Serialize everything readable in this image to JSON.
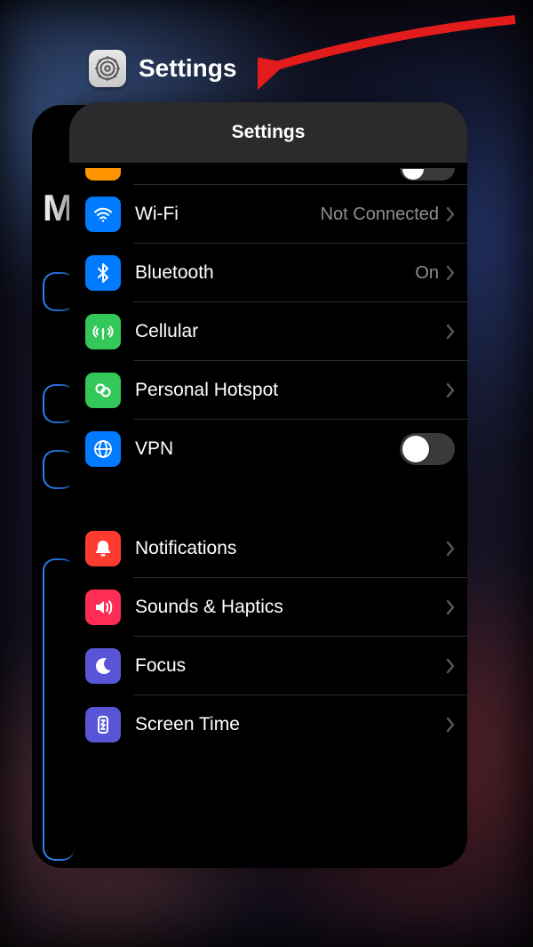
{
  "switcher": {
    "app_name": "Settings"
  },
  "header": {
    "title": "Settings"
  },
  "back_card": {
    "letter": "M"
  },
  "group1": {
    "wifi": {
      "label": "Wi-Fi",
      "value": "Not Connected"
    },
    "bt": {
      "label": "Bluetooth",
      "value": "On"
    },
    "cell": {
      "label": "Cellular"
    },
    "hotspot": {
      "label": "Personal Hotspot"
    },
    "vpn": {
      "label": "VPN",
      "on": false
    }
  },
  "group2": {
    "notif": {
      "label": "Notifications"
    },
    "sounds": {
      "label": "Sounds & Haptics"
    },
    "focus": {
      "label": "Focus"
    },
    "screen": {
      "label": "Screen Time"
    }
  },
  "colors": {
    "blue": "#007aff",
    "green": "#34c759",
    "red": "#ff3b30",
    "pink": "#ff2d55",
    "indigo": "#5856d6",
    "orange": "#ff9500"
  }
}
